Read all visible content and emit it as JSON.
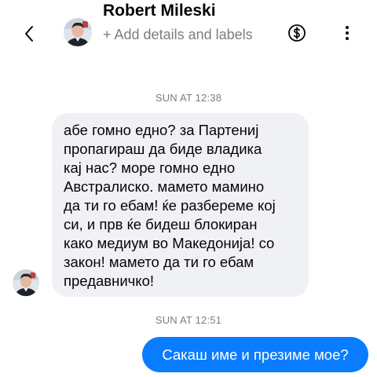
{
  "header": {
    "back_icon": "chevron-left-icon",
    "contact_name": "Robert Mileski",
    "add_details": "+ Add details and labels",
    "payment_icon": "dollar-circle-icon",
    "more_icon": "more-vertical-icon"
  },
  "conversation": {
    "timestamps": [
      "SUN AT 12:38",
      "SUN AT 12:51"
    ],
    "incoming_message": "абе гомно едно? за Партениј\nпропагираш да биде владика\nкај нас? море гомно едно\nАвстралиско. мамето мамино\nда ти го ебам! ќе разбереме кој\nси, и прв ќе бидеш блокиран\nкако медиум во Македонија! со\nзакон! мамето да ти го ебам\nпредавничко!",
    "outgoing_message": "Сакаш име и презиме мое?"
  },
  "colors": {
    "outgoing_bubble": "#0a7cff",
    "incoming_bubble": "#f0f1f4",
    "secondary_text": "#7a7d82"
  }
}
